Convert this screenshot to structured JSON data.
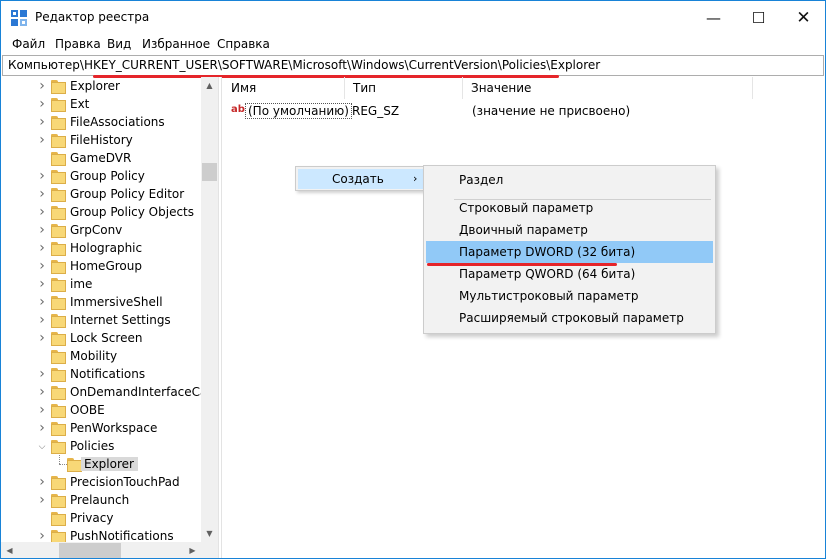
{
  "window": {
    "title": "Редактор реестра",
    "controls": {
      "minimize": "—",
      "maximize": "☐",
      "close": "✕"
    }
  },
  "menu": [
    "Файл",
    "Правка",
    "Вид",
    "Избранное",
    "Справка"
  ],
  "address": {
    "prefix": "Компьютер\\",
    "path": "HKEY_CURRENT_USER\\SOFTWARE\\Microsoft\\Windows\\CurrentVersion\\Policies\\Explorer"
  },
  "tree": [
    {
      "label": "Explorer",
      "expander": "collapsed"
    },
    {
      "label": "Ext",
      "expander": "collapsed"
    },
    {
      "label": "FileAssociations",
      "expander": "collapsed"
    },
    {
      "label": "FileHistory",
      "expander": "collapsed"
    },
    {
      "label": "GameDVR",
      "expander": "none"
    },
    {
      "label": "Group Policy",
      "expander": "collapsed"
    },
    {
      "label": "Group Policy Editor",
      "expander": "collapsed"
    },
    {
      "label": "Group Policy Objects",
      "expander": "collapsed"
    },
    {
      "label": "GrpConv",
      "expander": "collapsed"
    },
    {
      "label": "Holographic",
      "expander": "collapsed"
    },
    {
      "label": "HomeGroup",
      "expander": "collapsed"
    },
    {
      "label": "ime",
      "expander": "collapsed"
    },
    {
      "label": "ImmersiveShell",
      "expander": "collapsed"
    },
    {
      "label": "Internet Settings",
      "expander": "collapsed"
    },
    {
      "label": "Lock Screen",
      "expander": "collapsed"
    },
    {
      "label": "Mobility",
      "expander": "none"
    },
    {
      "label": "Notifications",
      "expander": "collapsed"
    },
    {
      "label": "OnDemandInterfaceCach",
      "expander": "collapsed"
    },
    {
      "label": "OOBE",
      "expander": "collapsed"
    },
    {
      "label": "PenWorkspace",
      "expander": "collapsed"
    },
    {
      "label": "Policies",
      "expander": "expanded"
    },
    {
      "label": "Explorer",
      "expander": "child",
      "selected": true
    },
    {
      "label": "PrecisionTouchPad",
      "expander": "collapsed"
    },
    {
      "label": "Prelaunch",
      "expander": "collapsed"
    },
    {
      "label": "Privacy",
      "expander": "none"
    },
    {
      "label": "PushNotifications",
      "expander": "collapsed"
    }
  ],
  "list": {
    "columns": [
      "Имя",
      "Тип",
      "Значение"
    ],
    "rows": [
      {
        "icon": "string-value-icon",
        "icon_text": "ab",
        "name": "(По умолчанию)",
        "type": "REG_SZ",
        "value": "(значение не присвоено)"
      }
    ]
  },
  "context_menu": {
    "item": "Создать",
    "arrow": "›"
  },
  "submenu": {
    "items": [
      {
        "label": "Раздел"
      },
      {
        "label": "Строковый параметр"
      },
      {
        "label": "Двоичный параметр"
      },
      {
        "label": "Параметр DWORD (32 бита)",
        "highlighted": true
      },
      {
        "label": "Параметр QWORD (64 бита)"
      },
      {
        "label": "Мультистроковый параметр"
      },
      {
        "label": "Расширяемый строковый параметр"
      }
    ]
  },
  "colors": {
    "highlight": "#91c9f7",
    "hover": "#cce8ff",
    "annotation": "#e5252a",
    "accent_border": "#1883d7"
  }
}
